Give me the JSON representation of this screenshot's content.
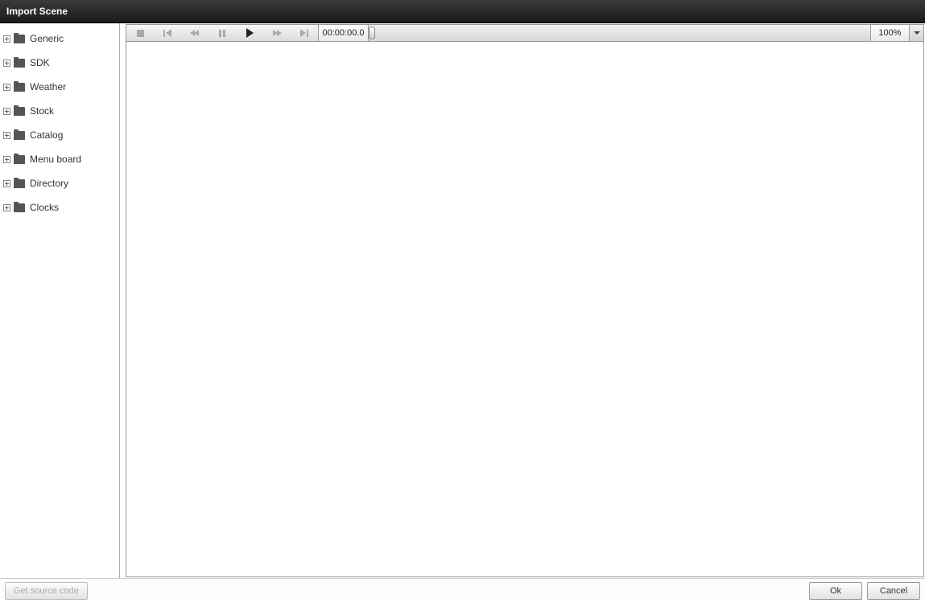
{
  "window": {
    "title": "Import Scene"
  },
  "sidebar": {
    "items": [
      {
        "label": "Generic"
      },
      {
        "label": "SDK"
      },
      {
        "label": "Weather"
      },
      {
        "label": "Stock"
      },
      {
        "label": "Catalog"
      },
      {
        "label": "Menu board"
      },
      {
        "label": "Directory"
      },
      {
        "label": "Clocks"
      }
    ]
  },
  "toolbar": {
    "timecode": "00:00:00.0",
    "zoom": "100%"
  },
  "footer": {
    "source_button": "Get source code",
    "ok": "Ok",
    "cancel": "Cancel"
  }
}
